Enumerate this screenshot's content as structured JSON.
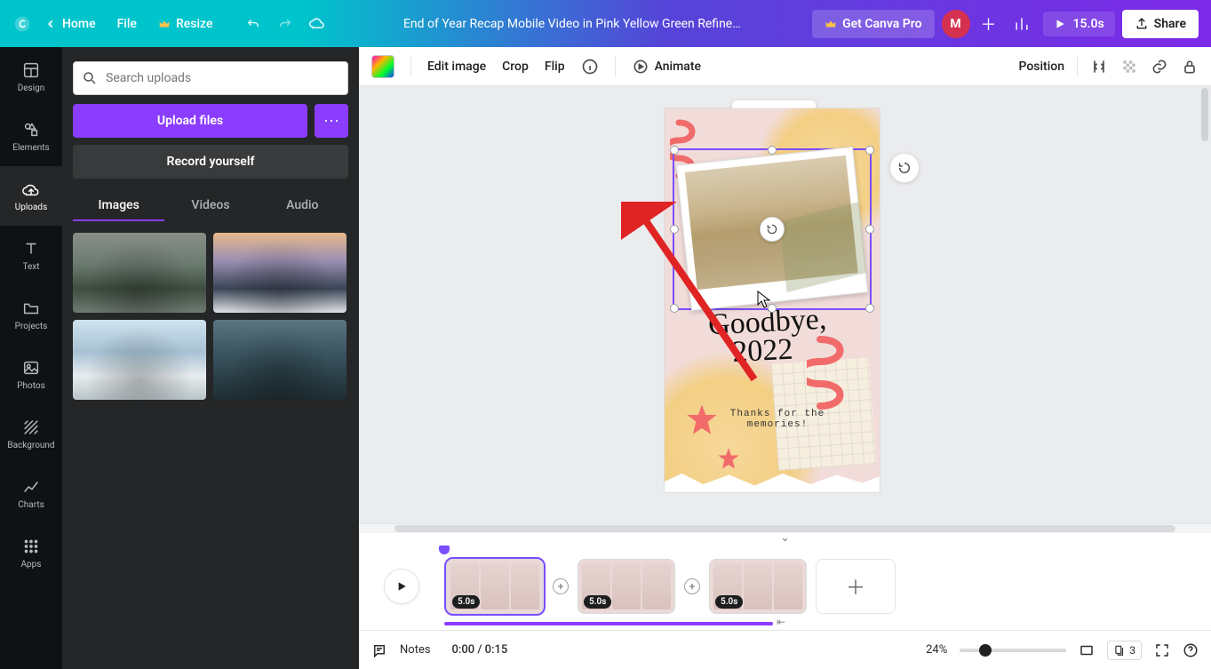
{
  "topbar": {
    "home": "Home",
    "file": "File",
    "resize": "Resize",
    "title": "End of Year Recap Mobile Video in Pink Yellow Green Refine…",
    "get_pro": "Get Canva Pro",
    "avatar_letter": "M",
    "duration": "15.0s",
    "share": "Share"
  },
  "rail": {
    "design": "Design",
    "elements": "Elements",
    "uploads": "Uploads",
    "text": "Text",
    "projects": "Projects",
    "photos": "Photos",
    "background": "Background",
    "charts": "Charts",
    "apps": "Apps"
  },
  "panel": {
    "search_placeholder": "Search uploads",
    "upload_label": "Upload files",
    "record_label": "Record yourself",
    "tabs": {
      "images": "Images",
      "videos": "Videos",
      "audio": "Audio"
    }
  },
  "context": {
    "edit_image": "Edit image",
    "crop": "Crop",
    "flip": "Flip",
    "animate": "Animate",
    "position": "Position"
  },
  "artboard": {
    "headline": "Goodbye,\n   2022",
    "subtext": "Thanks for the\nmemories!"
  },
  "timeline": {
    "clips": [
      {
        "duration": "5.0s"
      },
      {
        "duration": "5.0s"
      },
      {
        "duration": "5.0s"
      }
    ]
  },
  "bottom": {
    "notes": "Notes",
    "time": "0:00 / 0:15",
    "zoom": "24%",
    "page_count": "3"
  },
  "colors": {
    "accent": "#8b3dff"
  }
}
